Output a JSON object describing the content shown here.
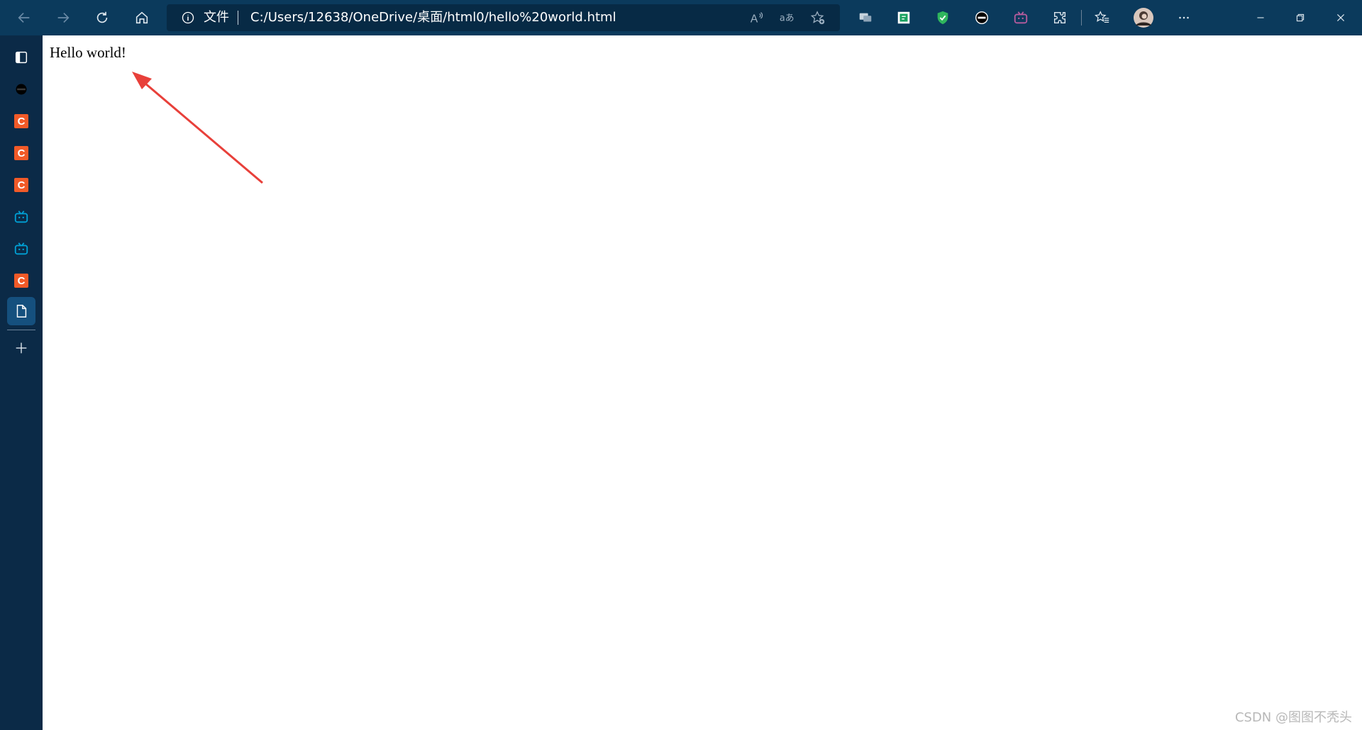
{
  "toolbar": {
    "address": {
      "security_label": "文件",
      "url": "C:/Users/12638/OneDrive/桌面/html0/hello%20world.html"
    }
  },
  "sidebar": {
    "items": [
      {
        "icon": "tab-actions-icon"
      },
      {
        "icon": "site-icon-dark"
      },
      {
        "icon": "csdn-icon",
        "letter": "C",
        "color": "#f25a28"
      },
      {
        "icon": "csdn-icon",
        "letter": "C",
        "color": "#f25a28"
      },
      {
        "icon": "csdn-icon",
        "letter": "C",
        "color": "#f25a28"
      },
      {
        "icon": "bilibili-icon",
        "color": "#00a1d6"
      },
      {
        "icon": "bilibili-icon",
        "color": "#00a1d6"
      },
      {
        "icon": "csdn-icon",
        "letter": "C",
        "color": "#f25a28"
      },
      {
        "icon": "file-icon",
        "active": true
      },
      {
        "icon": "add-icon"
      }
    ]
  },
  "page": {
    "text": "Hello world!"
  },
  "watermark": "CSDN @图图不秃头",
  "colors": {
    "toolbar_bg": "#0b3a5c",
    "sidebar_bg": "#0b2a47",
    "address_bg": "#072a45",
    "csdn_brand": "#f25a28",
    "annotation_arrow": "#e8403a"
  }
}
